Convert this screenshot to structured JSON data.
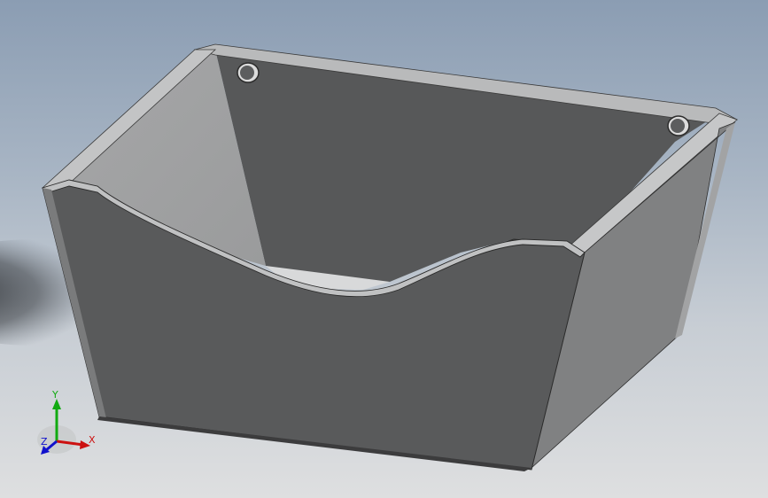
{
  "view": {
    "background_top": "#8b9db3",
    "background_bottom": "#dedfe0",
    "model": "sheet-metal-tray"
  },
  "triad": {
    "x_label": "X",
    "y_label": "Y",
    "z_label": "Z",
    "x_color": "#cc1111",
    "y_color": "#11aa11",
    "z_color": "#1111cc"
  }
}
